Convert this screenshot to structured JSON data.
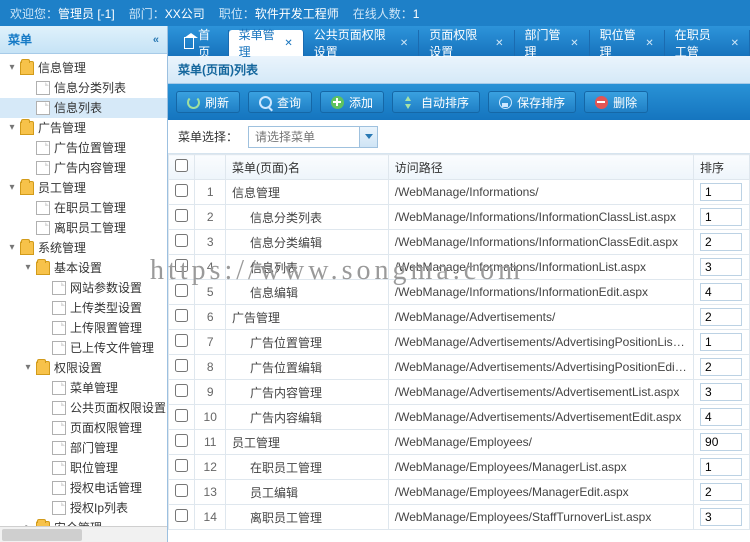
{
  "topbar": {
    "welcome_lbl": "欢迎您：",
    "welcome_val": "管理员 [-1]",
    "dept_lbl": "部门：",
    "dept_val": "XX公司",
    "pos_lbl": "职位：",
    "pos_val": "软件开发工程师",
    "online_lbl": "在线人数：",
    "online_val": "1"
  },
  "side": {
    "title": "菜单"
  },
  "tree": [
    {
      "d": 0,
      "t": "folder",
      "exp": true,
      "label": "信息管理"
    },
    {
      "d": 1,
      "t": "page",
      "label": "信息分类列表"
    },
    {
      "d": 1,
      "t": "page",
      "label": "信息列表",
      "sel": true
    },
    {
      "d": 0,
      "t": "folder",
      "exp": true,
      "label": "广告管理"
    },
    {
      "d": 1,
      "t": "page",
      "label": "广告位置管理"
    },
    {
      "d": 1,
      "t": "page",
      "label": "广告内容管理"
    },
    {
      "d": 0,
      "t": "folder",
      "exp": true,
      "label": "员工管理"
    },
    {
      "d": 1,
      "t": "page",
      "label": "在职员工管理"
    },
    {
      "d": 1,
      "t": "page",
      "label": "离职员工管理"
    },
    {
      "d": 0,
      "t": "folder",
      "exp": true,
      "label": "系统管理"
    },
    {
      "d": 1,
      "t": "folder",
      "exp": true,
      "label": "基本设置"
    },
    {
      "d": 2,
      "t": "page",
      "label": "网站参数设置"
    },
    {
      "d": 2,
      "t": "page",
      "label": "上传类型设置"
    },
    {
      "d": 2,
      "t": "page",
      "label": "上传限置管理"
    },
    {
      "d": 2,
      "t": "page",
      "label": "已上传文件管理"
    },
    {
      "d": 1,
      "t": "folder",
      "exp": true,
      "label": "权限设置"
    },
    {
      "d": 2,
      "t": "page",
      "label": "菜单管理"
    },
    {
      "d": 2,
      "t": "page",
      "label": "公共页面权限设置"
    },
    {
      "d": 2,
      "t": "page",
      "label": "页面权限管理"
    },
    {
      "d": 2,
      "t": "page",
      "label": "部门管理"
    },
    {
      "d": 2,
      "t": "page",
      "label": "职位管理"
    },
    {
      "d": 2,
      "t": "page",
      "label": "授权电话管理"
    },
    {
      "d": 2,
      "t": "page",
      "label": "授权Ip列表"
    },
    {
      "d": 1,
      "t": "folder",
      "exp": false,
      "label": "安全管理"
    }
  ],
  "tabs": [
    {
      "label": "首页",
      "home": true,
      "closable": false
    },
    {
      "label": "菜单管理",
      "active": true
    },
    {
      "label": "公共页面权限设置"
    },
    {
      "label": "页面权限设置"
    },
    {
      "label": "部门管理"
    },
    {
      "label": "职位管理"
    },
    {
      "label": "在职员工管"
    }
  ],
  "panel": {
    "title": "菜单(页面)列表"
  },
  "toolbar": {
    "refresh": "刷新",
    "search": "查询",
    "add": "添加",
    "autosort": "自动排序",
    "savesort": "保存排序",
    "delete": "删除"
  },
  "filter": {
    "label": "菜单选择：",
    "placeholder": "请选择菜单"
  },
  "grid": {
    "cols": {
      "name": "菜单(页面)名",
      "path": "访问路径",
      "sort": "排序"
    },
    "rows": [
      {
        "i": 1,
        "ind": 0,
        "name": "信息管理",
        "path": "/WebManage/Informations/",
        "sort": "1"
      },
      {
        "i": 2,
        "ind": 1,
        "name": "信息分类列表",
        "path": "/WebManage/Informations/InformationClassList.aspx",
        "sort": "1"
      },
      {
        "i": 3,
        "ind": 1,
        "name": "信息分类编辑",
        "path": "/WebManage/Informations/InformationClassEdit.aspx",
        "sort": "2"
      },
      {
        "i": 4,
        "ind": 1,
        "name": "信息列表",
        "path": "/WebManage/Informations/InformationList.aspx",
        "sort": "3"
      },
      {
        "i": 5,
        "ind": 1,
        "name": "信息编辑",
        "path": "/WebManage/Informations/InformationEdit.aspx",
        "sort": "4"
      },
      {
        "i": 6,
        "ind": 0,
        "name": "广告管理",
        "path": "/WebManage/Advertisements/",
        "sort": "2"
      },
      {
        "i": 7,
        "ind": 1,
        "name": "广告位置管理",
        "path": "/WebManage/Advertisements/AdvertisingPositionList.aspx",
        "sort": "1"
      },
      {
        "i": 8,
        "ind": 1,
        "name": "广告位置编辑",
        "path": "/WebManage/Advertisements/AdvertisingPositionEdit.aspx",
        "sort": "2"
      },
      {
        "i": 9,
        "ind": 1,
        "name": "广告内容管理",
        "path": "/WebManage/Advertisements/AdvertisementList.aspx",
        "sort": "3"
      },
      {
        "i": 10,
        "ind": 1,
        "name": "广告内容编辑",
        "path": "/WebManage/Advertisements/AdvertisementEdit.aspx",
        "sort": "4"
      },
      {
        "i": 11,
        "ind": 0,
        "name": "员工管理",
        "path": "/WebManage/Employees/",
        "sort": "90"
      },
      {
        "i": 12,
        "ind": 1,
        "name": "在职员工管理",
        "path": "/WebManage/Employees/ManagerList.aspx",
        "sort": "1"
      },
      {
        "i": 13,
        "ind": 1,
        "name": "员工编辑",
        "path": "/WebManage/Employees/ManagerEdit.aspx",
        "sort": "2"
      },
      {
        "i": 14,
        "ind": 1,
        "name": "离职员工管理",
        "path": "/WebManage/Employees/StaffTurnoverList.aspx",
        "sort": "3"
      }
    ]
  },
  "watermark": "https://www.songma.com"
}
